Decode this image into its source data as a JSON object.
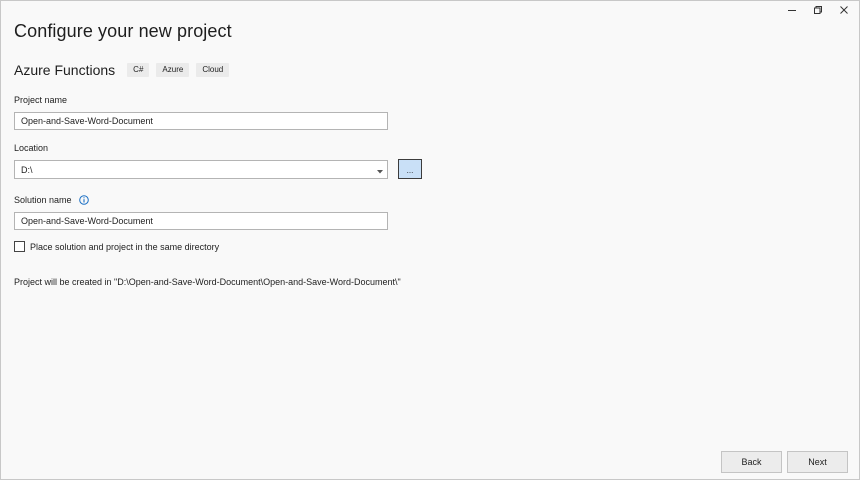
{
  "window": {
    "controls": [
      "minimize-icon",
      "restore-icon",
      "close-icon"
    ]
  },
  "header": {
    "title": "Configure your new project",
    "template_name": "Azure Functions",
    "tags": [
      "C#",
      "Azure",
      "Cloud"
    ]
  },
  "form": {
    "project_name_label": "Project name",
    "project_name_value": "Open-and-Save-Word-Document",
    "location_label": "Location",
    "location_value": "D:\\",
    "browse_label": "...",
    "solution_name_label": "Solution name",
    "solution_name_value": "Open-and-Save-Word-Document",
    "same_directory_label": "Place solution and project in the same directory",
    "same_directory_checked": false,
    "path_note": "Project will be created in \"D:\\Open-and-Save-Word-Document\\Open-and-Save-Word-Document\\\""
  },
  "footer": {
    "back_label": "Back",
    "next_label": "Next"
  },
  "colors": {
    "background": "#f9f9f9",
    "tag_bg": "#ebebeb",
    "browse_bg": "#c9e0f7",
    "info_icon": "#1a6fc4",
    "button_bg": "#ececec"
  }
}
